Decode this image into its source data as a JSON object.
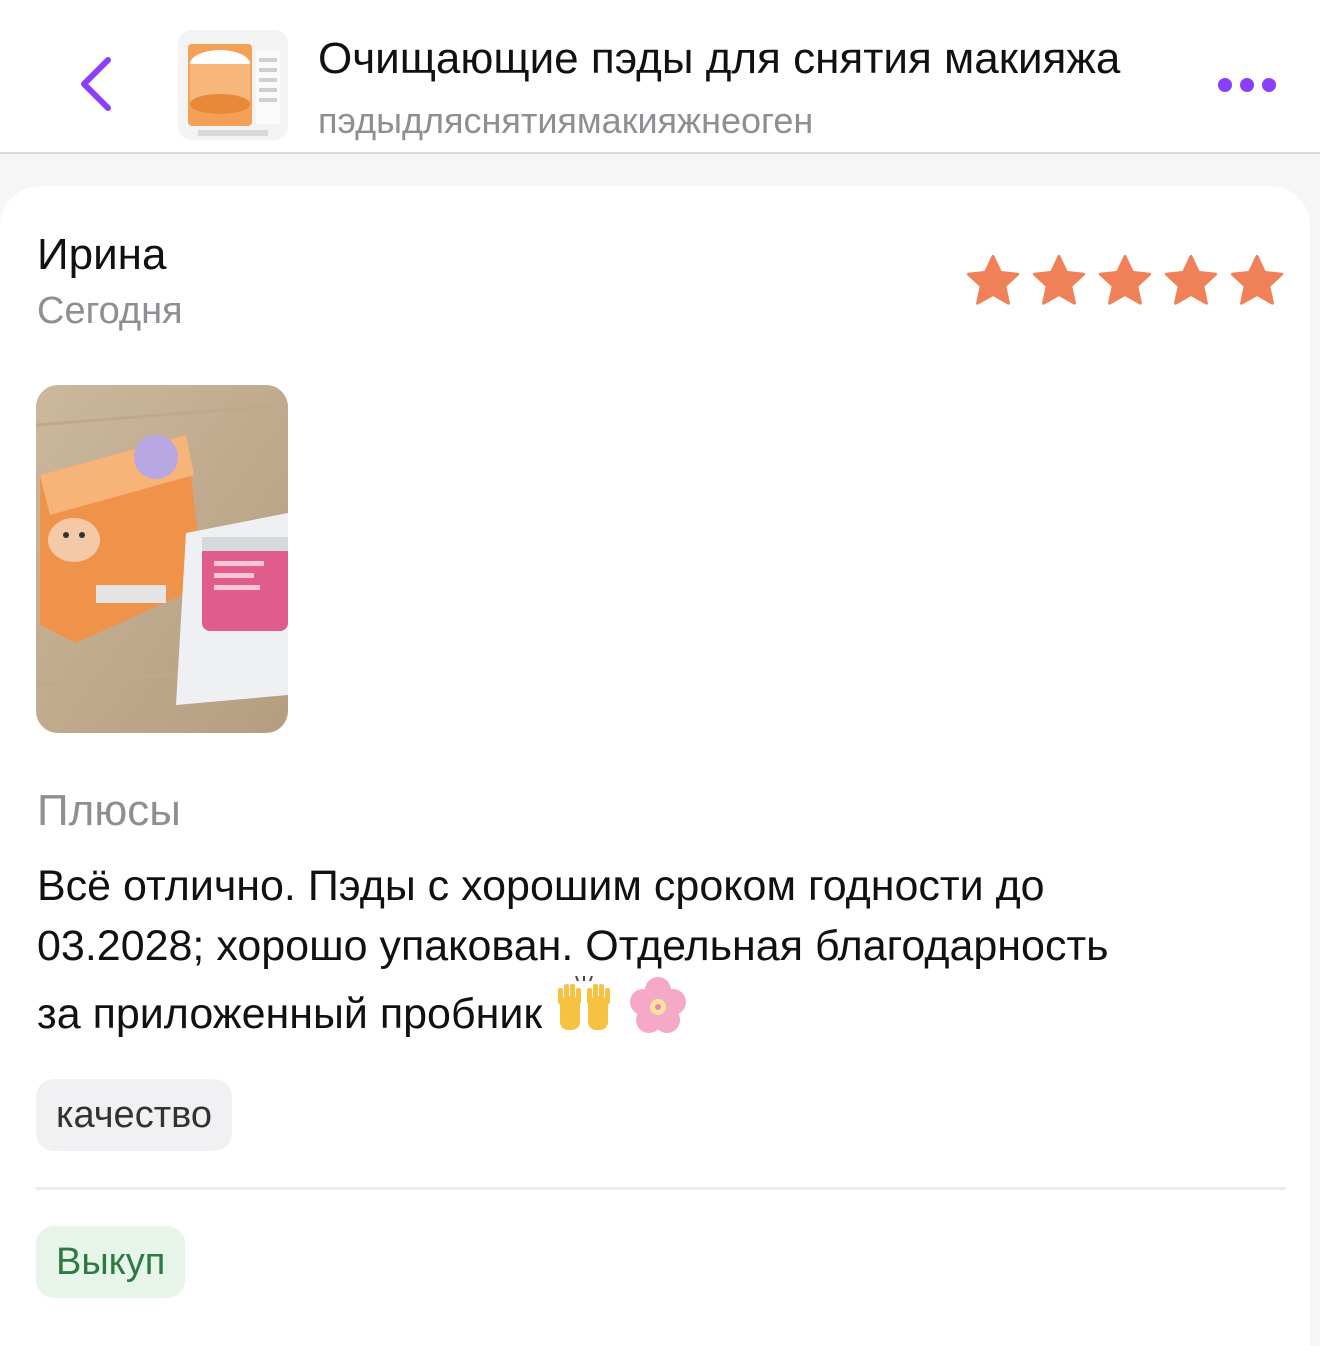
{
  "header": {
    "title": "Очищающие пэды для снятия макияжа",
    "subtitle": "пэдыдляснятиямакияжнеоген",
    "accent_color": "#8a3ffc",
    "back_icon": "chevron-left-icon",
    "more_icon": "ellipsis-icon"
  },
  "review": {
    "author": "Ирина",
    "date": "Сегодня",
    "rating": 5,
    "rating_max": 5,
    "star_color": "#f08058",
    "pros_label": "Плюсы",
    "text_line1": "Всё отлично. Пэды с хорошим сроком годности до",
    "text_line2": "03.2028; хорошо упакован. Отдельная благодарность",
    "text_line3": "за приложенный пробник",
    "emojis": [
      "raising-hands-emoji",
      "cherry-blossom-emoji"
    ],
    "tag": "качество",
    "badge": "Выкуп"
  }
}
